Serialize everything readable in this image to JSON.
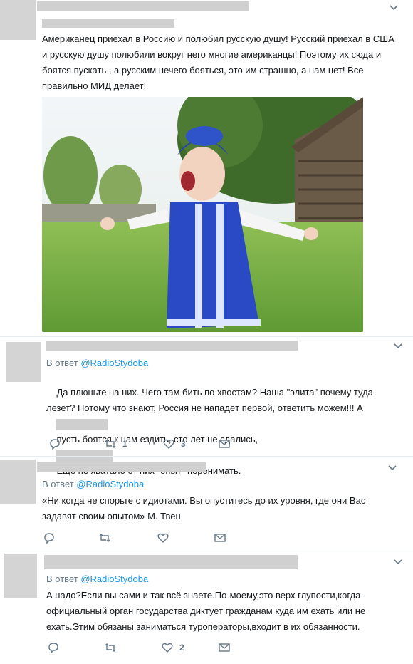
{
  "tweet1": {
    "text": "Американец приехал в Россию и полюбил русскую душу! Русский приехал в США и русскую душу полюбили вокруг него многие американцы! Поэтому их сюда и боятся пускать , а русским нечего бояться, это им страшно, а нам нет! Все правильно МИД делает!"
  },
  "tweet2": {
    "reply_prefix": "В ответ",
    "reply_handle": "@RadioStydoba",
    "text_a": "Да плюньте на них. Чего там бить по хвостам? Наша \"элита\" почему туда лезет? Потому что знают, Россия не нападёт первой, ответить можем!!! А",
    "text_b": "пусть боятся к нам ездить, сто лет не сдались,",
    "text_c": "Ещё не хватало от них \"опыт\" перенимать.",
    "retweets": "1",
    "likes": "3"
  },
  "tweet3": {
    "reply_prefix": "В ответ",
    "reply_handle": "@RadioStydoba",
    "text": "«Ни когда не спорьте с идиотами. Вы опуститесь до их уровня, где они Вас задавят своим опытом» М. Твен"
  },
  "tweet4": {
    "reply_prefix": "В ответ",
    "reply_handle": "@RadioStydoba",
    "text": "А надо?Если вы сами и так всё знаете.По-моему,это верх глупости,когда официальный орган государства диктует гражданам куда им ехать или не ехать.Этим обязаны заниматься туроператоры,входит в их обязанности.",
    "likes": "2"
  }
}
